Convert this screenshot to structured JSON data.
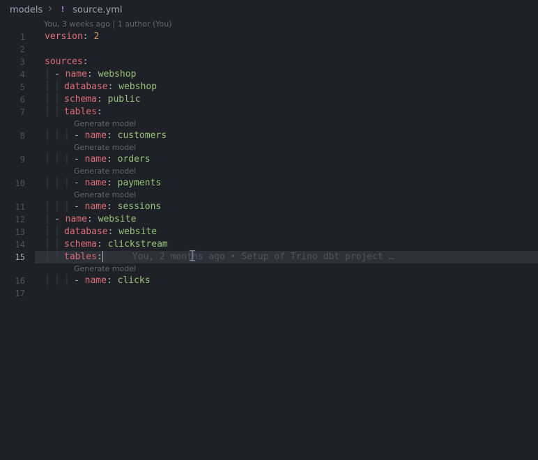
{
  "breadcrumb": {
    "folder": "models",
    "file": "source.yml"
  },
  "author_line": "You, 3 weeks ago | 1 author (You)",
  "codelens_label": "Generate model",
  "active_blame": "You, 2 months ago • Setup of Trino dbt project …",
  "yaml": {
    "version_key": "version",
    "version_val": "2",
    "sources_key": "sources",
    "name_key": "name",
    "database_key": "database",
    "schema_key": "schema",
    "tables_key": "tables",
    "src1": {
      "name": "webshop",
      "database": "webshop",
      "schema": "public",
      "tables": [
        "customers",
        "orders",
        "payments",
        "sessions"
      ]
    },
    "src2": {
      "name": "website",
      "database": "website",
      "schema": "clickstream",
      "tables": [
        "clicks"
      ]
    }
  },
  "line_numbers": [
    "1",
    "2",
    "3",
    "4",
    "5",
    "6",
    "7",
    "8",
    "9",
    "10",
    "11",
    "12",
    "13",
    "14",
    "15",
    "16",
    "17"
  ]
}
